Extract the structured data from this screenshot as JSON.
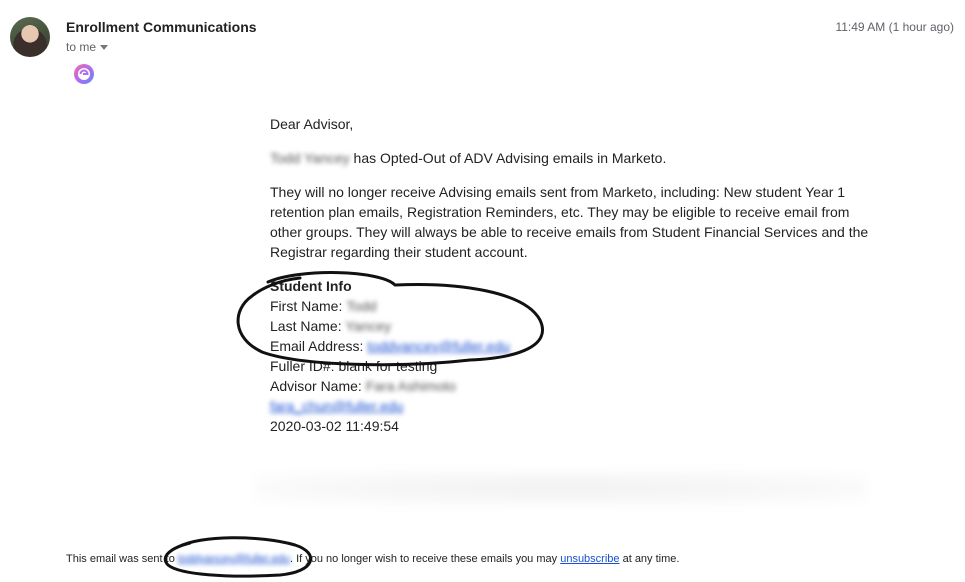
{
  "header": {
    "sender": "Enrollment Communications",
    "recipient": "to me",
    "timestamp": "11:49 AM (1 hour ago)"
  },
  "message": {
    "greeting": "Dear Advisor,",
    "student_name": "Todd Yancey",
    "optout_text": " has Opted-Out of ADV Advising emails in Marketo.",
    "paragraph": "They will no longer receive Advising emails sent from Marketo, including: New student Year 1 retention plan emails, Registration Reminders, etc. They may be eligible to receive email from other groups. They will always be able to receive emails from Student Financial Services and the Registrar regarding their student account.",
    "info_title": "Student Info",
    "first_name_label": "First Name: ",
    "first_name_value": "Todd",
    "last_name_label": "Last Name: ",
    "last_name_value": "Yancey",
    "email_label": "Email Address: ",
    "email_value": "toddyancey@fuller.edu",
    "fuller_id_line": "Fuller ID#: blank for testing",
    "advisor_label": "Advisor Name: ",
    "advisor_value": "Fara Ashimoto",
    "advisor_email": "fara_chun@fuller.edu",
    "date_time": "2020-03-02 11:49:54"
  },
  "footer": {
    "prefix": "This email was sent to ",
    "sent_to": "toddyancey@fuller.edu",
    "middle": ". If you no longer wish to receive these emails you may ",
    "unsubscribe": "unsubscribe",
    "suffix": " at any time."
  }
}
